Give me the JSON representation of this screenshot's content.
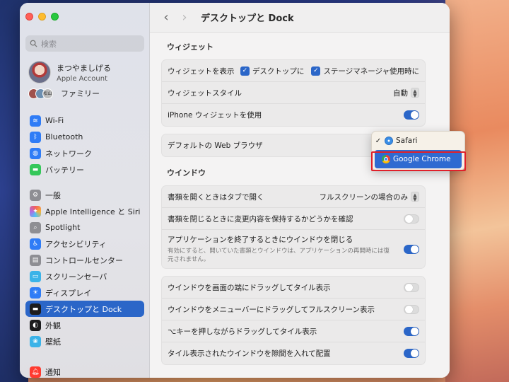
{
  "sidebar": {
    "search_placeholder": "検索",
    "account": {
      "name": "まつやましげる",
      "sub": "Apple Account"
    },
    "family": {
      "label": "ファミリー",
      "badge": "松山"
    },
    "items": [
      {
        "label": "Wi‑Fi",
        "icon": "wifi-icon",
        "color": "#2f7cf6"
      },
      {
        "label": "Bluetooth",
        "icon": "bluetooth-icon",
        "color": "#2f7cf6"
      },
      {
        "label": "ネットワーク",
        "icon": "globe-icon",
        "color": "#2f7cf6"
      },
      {
        "label": "バッテリー",
        "icon": "battery-icon",
        "color": "#34c759"
      },
      {
        "label": "一般",
        "icon": "gear-icon",
        "color": "#8e8e93"
      },
      {
        "label": "Apple Intelligence と Siri",
        "icon": "apple-intelligence-icon",
        "color": "#d66ad6"
      },
      {
        "label": "Spotlight",
        "icon": "spotlight-icon",
        "color": "#8e8e93"
      },
      {
        "label": "アクセシビリティ",
        "icon": "accessibility-icon",
        "color": "#2f7cf6"
      },
      {
        "label": "コントロールセンター",
        "icon": "control-center-icon",
        "color": "#8e8e93"
      },
      {
        "label": "スクリーンセーバ",
        "icon": "screensaver-icon",
        "color": "#3bb3e8"
      },
      {
        "label": "ディスプレイ",
        "icon": "display-icon",
        "color": "#2f7cf6"
      },
      {
        "label": "デスクトップと Dock",
        "icon": "desktop-dock-icon",
        "color": "#1c1c1e"
      },
      {
        "label": "外観",
        "icon": "appearance-icon",
        "color": "#1c1c1e"
      },
      {
        "label": "壁紙",
        "icon": "wallpaper-icon",
        "color": "#3bb3e8"
      },
      {
        "label": "通知",
        "icon": "notifications-icon",
        "color": "#ff3b30"
      }
    ],
    "active_index": 11
  },
  "header": {
    "title": "デスクトップと Dock",
    "back": "‹",
    "forward": "›"
  },
  "widgets": {
    "title": "ウィジェット",
    "show_label": "ウィジェットを表示",
    "show_desktop": "デスクトップに",
    "show_stage": "ステージマネージャ使用時に",
    "style_label": "ウィジェットスタイル",
    "style_value": "自動",
    "iphone_label": "iPhone ウィジェットを使用",
    "iphone_on": true
  },
  "browser": {
    "label": "デフォルトの Web ブラウザ",
    "options": [
      "Safari",
      "Google Chrome"
    ],
    "checked": "Safari",
    "highlighted": "Google Chrome"
  },
  "windows": {
    "title": "ウインドウ",
    "open_tabs_label": "書類を開くときはタブで開く",
    "open_tabs_value": "フルスクリーンの場合のみ",
    "ask_keep_label": "書類を閉じるときに変更内容を保持するかどうかを確認",
    "ask_keep_on": false,
    "close_windows_label": "アプリケーションを終了するときにウインドウを閉じる",
    "close_windows_sub": "有効にすると、開いていた書類とウインドウは、アプリケーションの再開時には復元されません。",
    "close_windows_on": true,
    "tile_edge_label": "ウインドウを画面の端にドラッグしてタイル表示",
    "tile_edge_on": false,
    "menubar_full_label": "ウインドウをメニューバーにドラッグしてフルスクリーン表示",
    "menubar_full_on": false,
    "option_tile_label": "⌥キーを押しながらドラッグしてタイル表示",
    "option_tile_on": true,
    "tiled_margin_label": "タイル表示されたウインドウを隙間を入れて配置",
    "tiled_margin_on": true
  }
}
